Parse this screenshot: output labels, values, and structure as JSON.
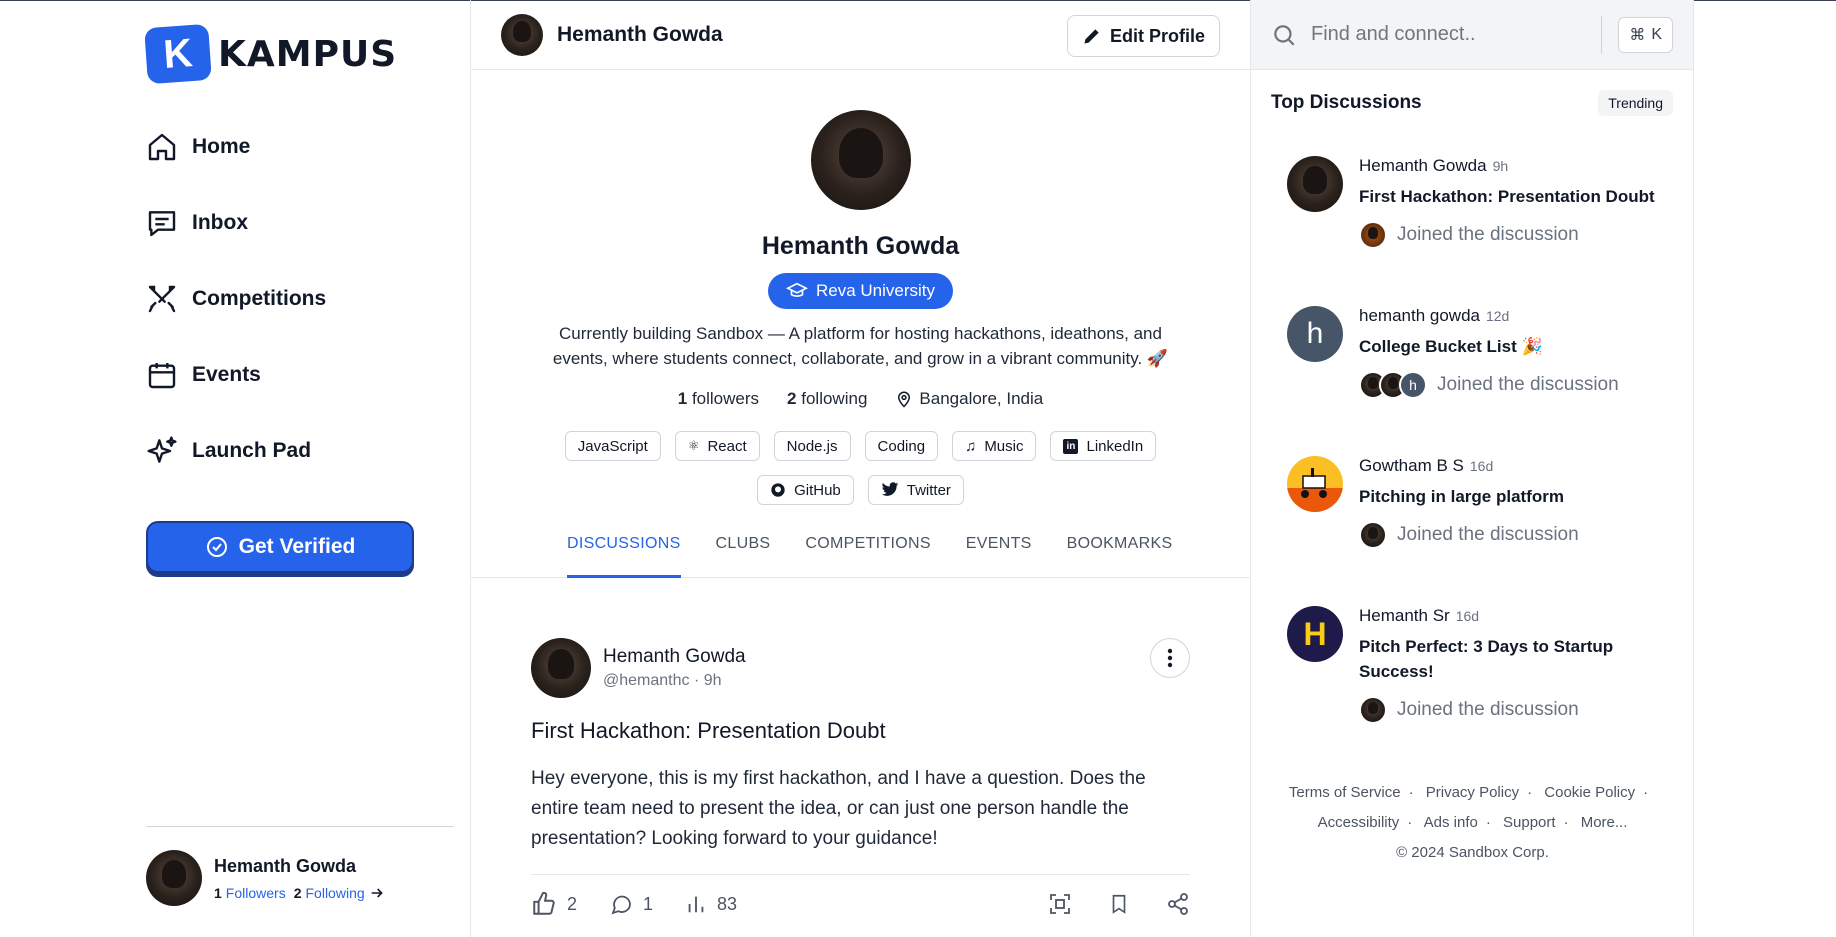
{
  "app": {
    "name": "KAMPUS",
    "logo_letter": "K"
  },
  "nav": [
    {
      "label": "Home",
      "icon": "home-icon"
    },
    {
      "label": "Inbox",
      "icon": "inbox-icon"
    },
    {
      "label": "Competitions",
      "icon": "swords-icon"
    },
    {
      "label": "Events",
      "icon": "calendar-icon"
    },
    {
      "label": "Launch Pad",
      "icon": "sparkles-icon"
    }
  ],
  "get_verified": {
    "label": "Get Verified"
  },
  "current_user": {
    "name": "Hemanth Gowda",
    "followers_count": "1",
    "followers_label": "Followers",
    "following_count": "2",
    "following_label": "Following"
  },
  "header": {
    "name": "Hemanth Gowda",
    "edit_label": "Edit Profile"
  },
  "profile": {
    "name": "Hemanth Gowda",
    "university": "Reva University",
    "bio": "Currently building Sandbox — A platform for hosting hackathons, ideathons, and events, where students connect, collaborate, and grow in a vibrant community. 🚀",
    "followers_count": "1",
    "followers_label": "followers",
    "following_count": "2",
    "following_label": "following",
    "location": "Bangalore, India",
    "tags": [
      "JavaScript",
      "React",
      "Node.js",
      "Coding",
      "Music",
      "LinkedIn",
      "GitHub",
      "Twitter"
    ]
  },
  "tabs": [
    "DISCUSSIONS",
    "CLUBS",
    "COMPETITIONS",
    "EVENTS",
    "BOOKMARKS"
  ],
  "post": {
    "author": "Hemanth Gowda",
    "handle": "@hemanthc",
    "time": "9h",
    "title": "First Hackathon: Presentation Doubt",
    "body": " Hey everyone, this is my first hackathon, and I have a question. Does the entire team need to present the idea, or can just one person handle the presentation? Looking forward to your guidance!",
    "likes": "2",
    "comments": "1",
    "views": "83"
  },
  "search": {
    "placeholder": "Find and connect..",
    "shortcut_symbol": "⌘",
    "shortcut_key": "K"
  },
  "top_discussions": {
    "title": "Top Discussions",
    "badge": "Trending",
    "items": [
      {
        "author": "Hemanth Gowda",
        "time": "9h",
        "title": "First Hackathon: Presentation Doubt",
        "joined": "Joined the discussion"
      },
      {
        "author": "hemanth gowda",
        "time": "12d",
        "title": "College Bucket List 🎉",
        "joined": "Joined the discussion",
        "avatar_letter": "h"
      },
      {
        "author": "Gowtham B S",
        "time": "16d",
        "title": "Pitching in large platform",
        "joined": "Joined the discussion"
      },
      {
        "author": "Hemanth Sr",
        "time": "16d",
        "title": "Pitch Perfect: 3 Days to Startup Success!",
        "joined": "Joined the discussion",
        "avatar_letter": "H"
      }
    ]
  },
  "footer": {
    "links": [
      "Terms of Service",
      "Privacy Policy",
      "Cookie Policy",
      "Accessibility",
      "Ads info",
      "Support",
      "More..."
    ],
    "copyright": "© 2024 Sandbox Corp."
  },
  "colors": {
    "accent": "#2563eb",
    "border": "#e5e7eb",
    "muted": "#6b7280"
  }
}
